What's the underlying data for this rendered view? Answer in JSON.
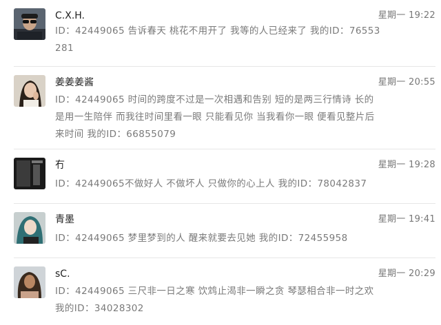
{
  "comments": [
    {
      "name": "C.X.H.",
      "time": "星期一 19:22",
      "message": "ID：42449065 告诉春天 桃花不用开了 我等的人已经来了 我的ID：76553281"
    },
    {
      "name": "姜姜姜酱",
      "time": "星期一 20:55",
      "message": "ID：42449065 时间的跨度不过是一次相遇和告别 短的是两三行情诗 长的是用一生陪伴 而我往时间里看一眼 只能看见你 当我看你一眼 便看见整片后来时间 我的ID：66855079"
    },
    {
      "name": "冇",
      "time": "星期一 19:28",
      "message": "ID：42449065不做好人 不做坏人 只做你的心上人 我的ID：78042837"
    },
    {
      "name": "青墨",
      "time": "星期一 19:41",
      "message": "ID：42449065 梦里梦到的人 醒来就要去见她 我的ID：72455958"
    },
    {
      "name": "sC.",
      "time": "星期一 20:29",
      "message": "ID：42449065 三尺非一日之寒 饮鸩止渴非一瞬之贪 琴瑟相合非一时之欢 我的ID：34028302"
    }
  ],
  "avatars": [
    "avatar-sunglasses-man",
    "avatar-woman-hand-to-face",
    "avatar-dark-room",
    "avatar-girl-teal-hair",
    "avatar-curly-hair-woman"
  ]
}
